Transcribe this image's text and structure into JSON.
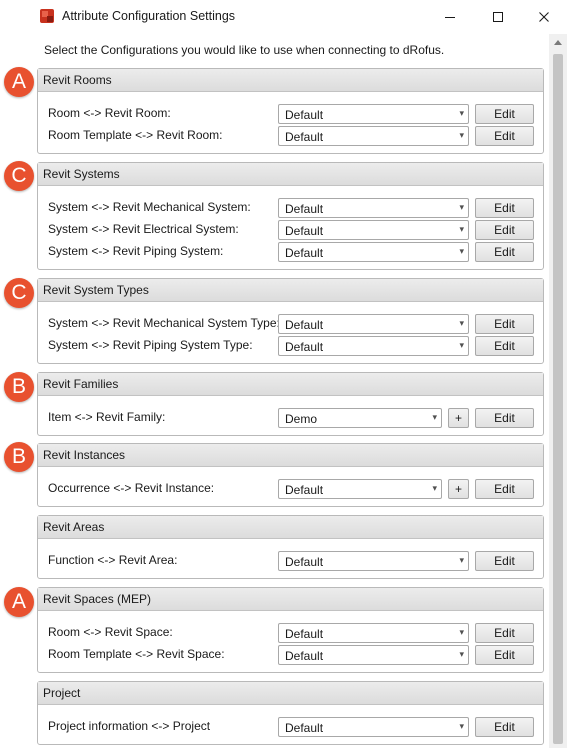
{
  "window": {
    "title": "Attribute Configuration Settings",
    "minimize_icon": "minimize-icon",
    "maximize_icon": "maximize-icon",
    "close_icon": "close-icon"
  },
  "instruction": "Select the Configurations you would like to use when connecting to dRofus.",
  "markers": [
    "A",
    "C",
    "C",
    "B",
    "B",
    "A"
  ],
  "edit_label": "Edit",
  "plus_label": "+",
  "groups": [
    {
      "title": "Revit Rooms",
      "rows": [
        {
          "label": "Room <-> Revit Room:",
          "value": "Default"
        },
        {
          "label": "Room Template <-> Revit Room:",
          "value": "Default"
        }
      ]
    },
    {
      "title": "Revit Systems",
      "rows": [
        {
          "label": "System <-> Revit Mechanical System:",
          "value": "Default"
        },
        {
          "label": "System <-> Revit Electrical System:",
          "value": "Default"
        },
        {
          "label": "System <-> Revit Piping System:",
          "value": "Default"
        }
      ]
    },
    {
      "title": "Revit System Types",
      "rows": [
        {
          "label": "System <-> Revit Mechanical System Type:",
          "value": "Default"
        },
        {
          "label": "System <-> Revit Piping System Type:",
          "value": "Default"
        }
      ]
    },
    {
      "title": "Revit Families",
      "rows": [
        {
          "label": "Item <-> Revit Family:",
          "value": "Demo"
        }
      ]
    },
    {
      "title": "Revit Instances",
      "rows": [
        {
          "label": "Occurrence <-> Revit Instance:",
          "value": "Default"
        }
      ]
    },
    {
      "title": "Revit Areas",
      "rows": [
        {
          "label": "Function <-> Revit Area:",
          "value": "Default"
        }
      ]
    },
    {
      "title": "Revit Spaces (MEP)",
      "rows": [
        {
          "label": "Room <-> Revit Space:",
          "value": "Default"
        },
        {
          "label": "Room Template <-> Revit Space:",
          "value": "Default"
        }
      ]
    },
    {
      "title": "Project",
      "rows": [
        {
          "label": "Project information <-> Project",
          "value": "Default"
        }
      ]
    }
  ]
}
